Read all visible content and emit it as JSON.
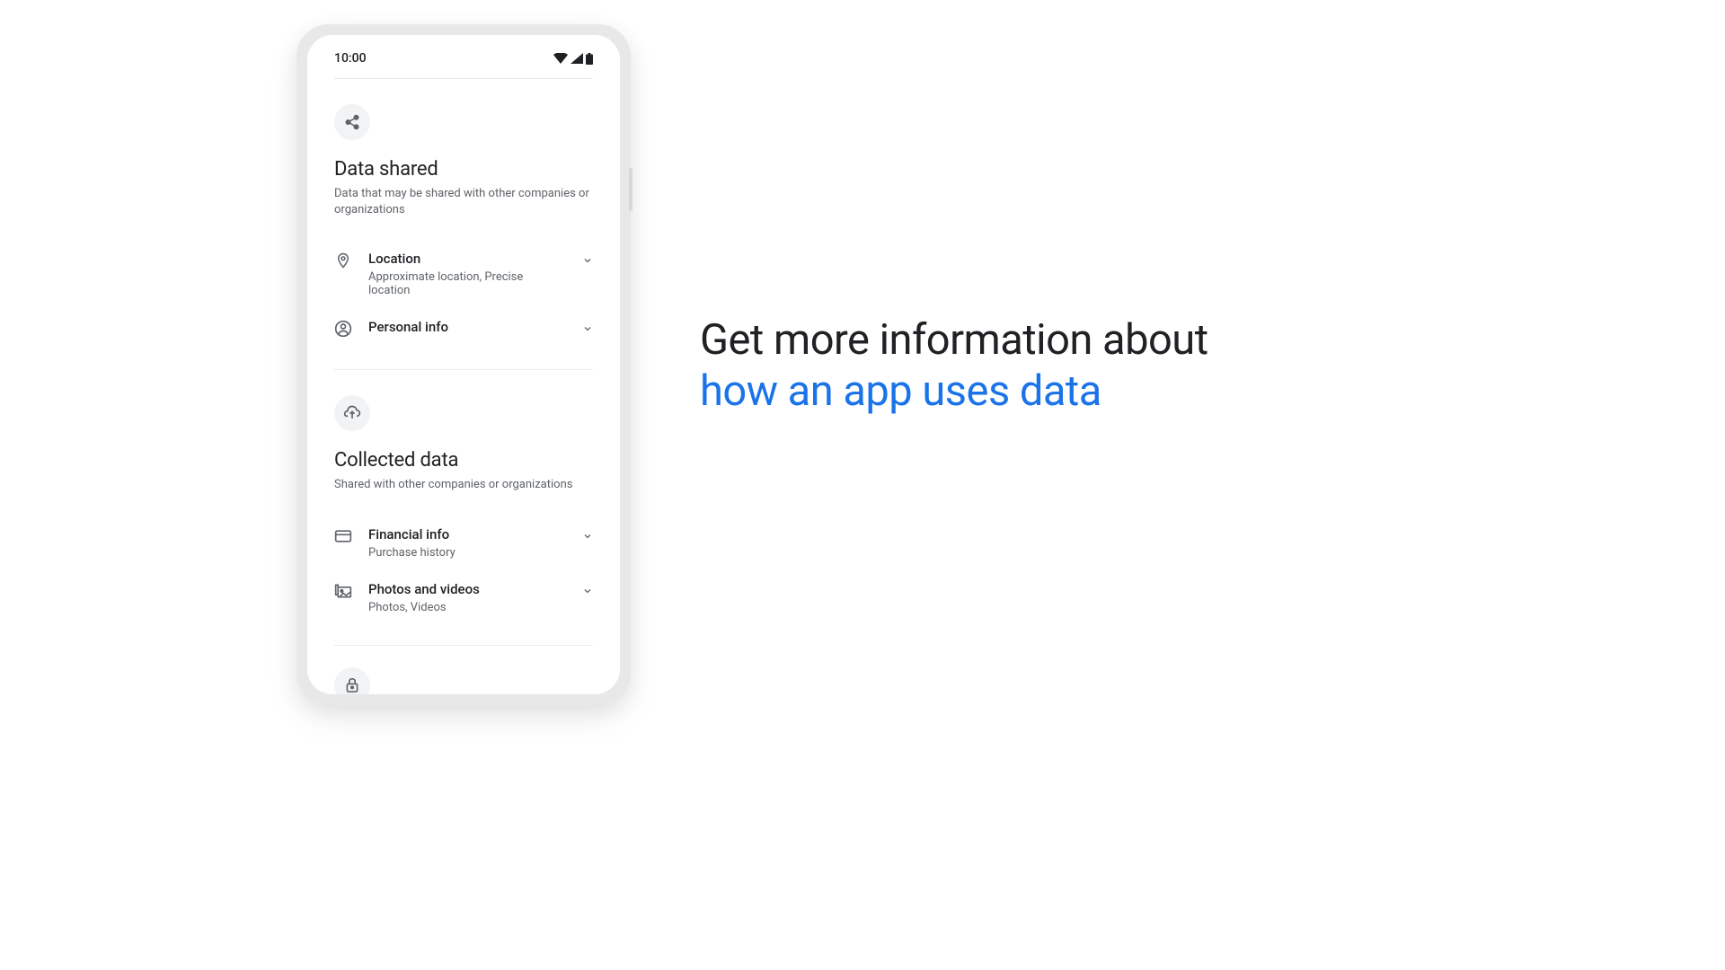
{
  "status_bar": {
    "time": "10:00"
  },
  "sections": {
    "shared": {
      "title": "Data shared",
      "subtitle": "Data that may be shared with other companies or organizations",
      "items": [
        {
          "title": "Location",
          "subtitle": "Approximate location, Precise location"
        },
        {
          "title": "Personal info",
          "subtitle": ""
        }
      ]
    },
    "collected": {
      "title": "Collected data",
      "subtitle": "Shared with other companies or organizations",
      "items": [
        {
          "title": "Financial info",
          "subtitle": "Purchase history"
        },
        {
          "title": "Photos and videos",
          "subtitle": "Photos, Videos"
        }
      ]
    }
  },
  "headline": {
    "line1": "Get more information about",
    "line2": "how an app uses data"
  }
}
